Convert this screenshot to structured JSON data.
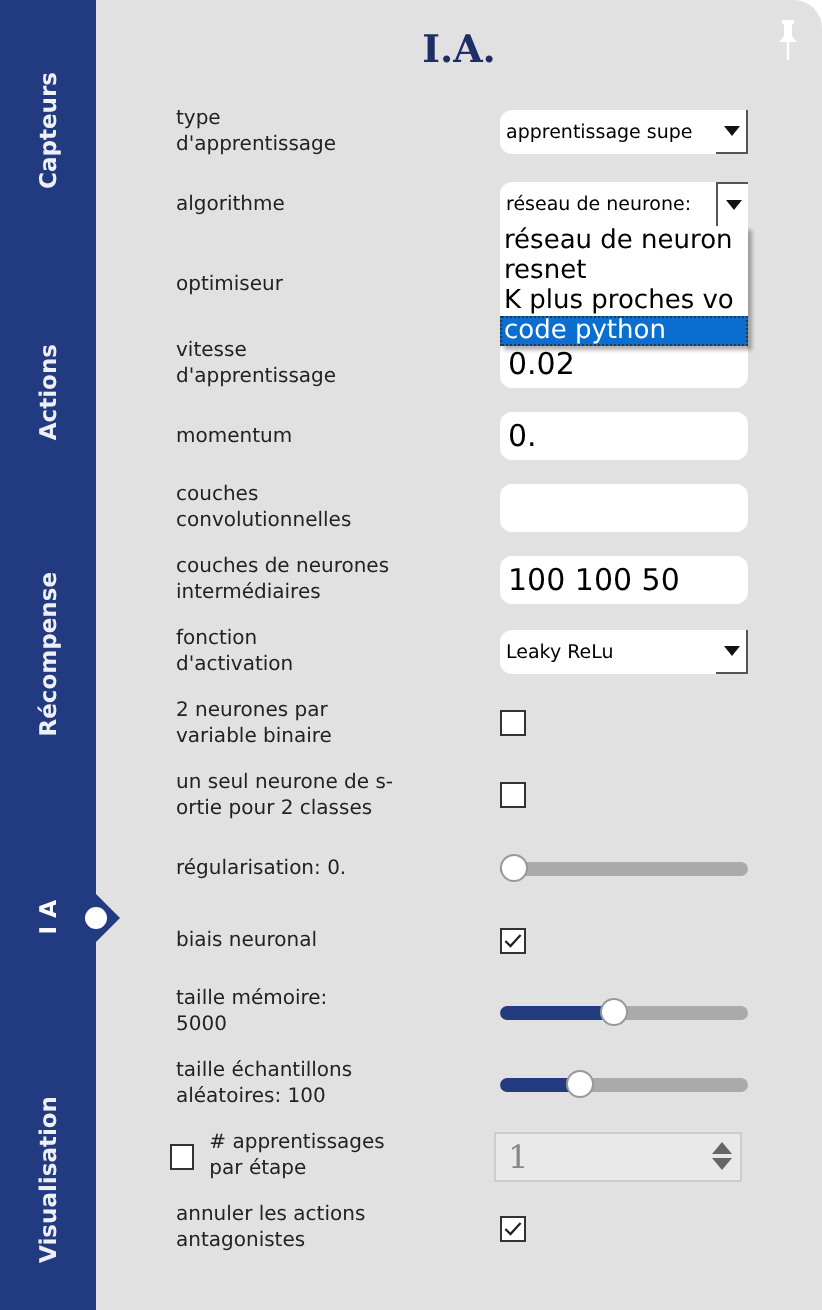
{
  "tabs": [
    {
      "label": "Capteurs",
      "selected": false
    },
    {
      "label": "Actions",
      "selected": false
    },
    {
      "label": "Récompense",
      "selected": false
    },
    {
      "label": "I A",
      "selected": true
    },
    {
      "label": "Visualisation",
      "selected": false
    }
  ],
  "panel": {
    "title": "I.A.",
    "pinned": true
  },
  "settings": [
    {
      "kind": "dropdown",
      "label": "type\nd'apprentissage",
      "value": "apprentissage supe"
    },
    {
      "kind": "dropdown",
      "label": "algorithme",
      "value": "réseau de neurone:",
      "expanded": true,
      "options": [
        {
          "label": "réseau de neuron",
          "selected": false
        },
        {
          "label": "resnet",
          "selected": false
        },
        {
          "label": "K plus proches vo",
          "selected": false
        },
        {
          "label": "code python",
          "selected": true
        }
      ]
    },
    {
      "kind": "hidden",
      "label": "optimiseur"
    },
    {
      "kind": "field",
      "label": "vitesse\nd'apprentissage",
      "value": "0.02"
    },
    {
      "kind": "field",
      "label": "momentum",
      "value": "0."
    },
    {
      "kind": "field",
      "label": "couches\nconvolutionnelles"
    },
    {
      "kind": "field",
      "label": "couches de neurones\nintermédiaires",
      "value": "100 100 50"
    },
    {
      "kind": "dropdown",
      "label": "fonction\nd'activation",
      "value": "Leaky ReLu"
    },
    {
      "kind": "checkbox",
      "label": "2 neurones par\nvariable binaire",
      "checked": false
    },
    {
      "kind": "checkbox",
      "label": "un seul neurone de s-\nortie pour 2 classes",
      "checked": false
    },
    {
      "kind": "slider",
      "label": "régularisation: 0.",
      "level": 0
    },
    {
      "kind": "checkbox",
      "label": "biais neuronal",
      "checked": true
    },
    {
      "kind": "slider",
      "label": "taille mémoire:\n5000",
      "level": 0.45
    },
    {
      "kind": "slider",
      "label": "taille échantillons\naléatoires: 100",
      "level": 0.3
    },
    {
      "kind": "spin",
      "label": "# apprentissages\npar étape",
      "checked": false,
      "value": "1",
      "disabled": true
    },
    {
      "kind": "checkbox",
      "label": "annuler les actions\nantagonistes",
      "checked": true
    }
  ]
}
